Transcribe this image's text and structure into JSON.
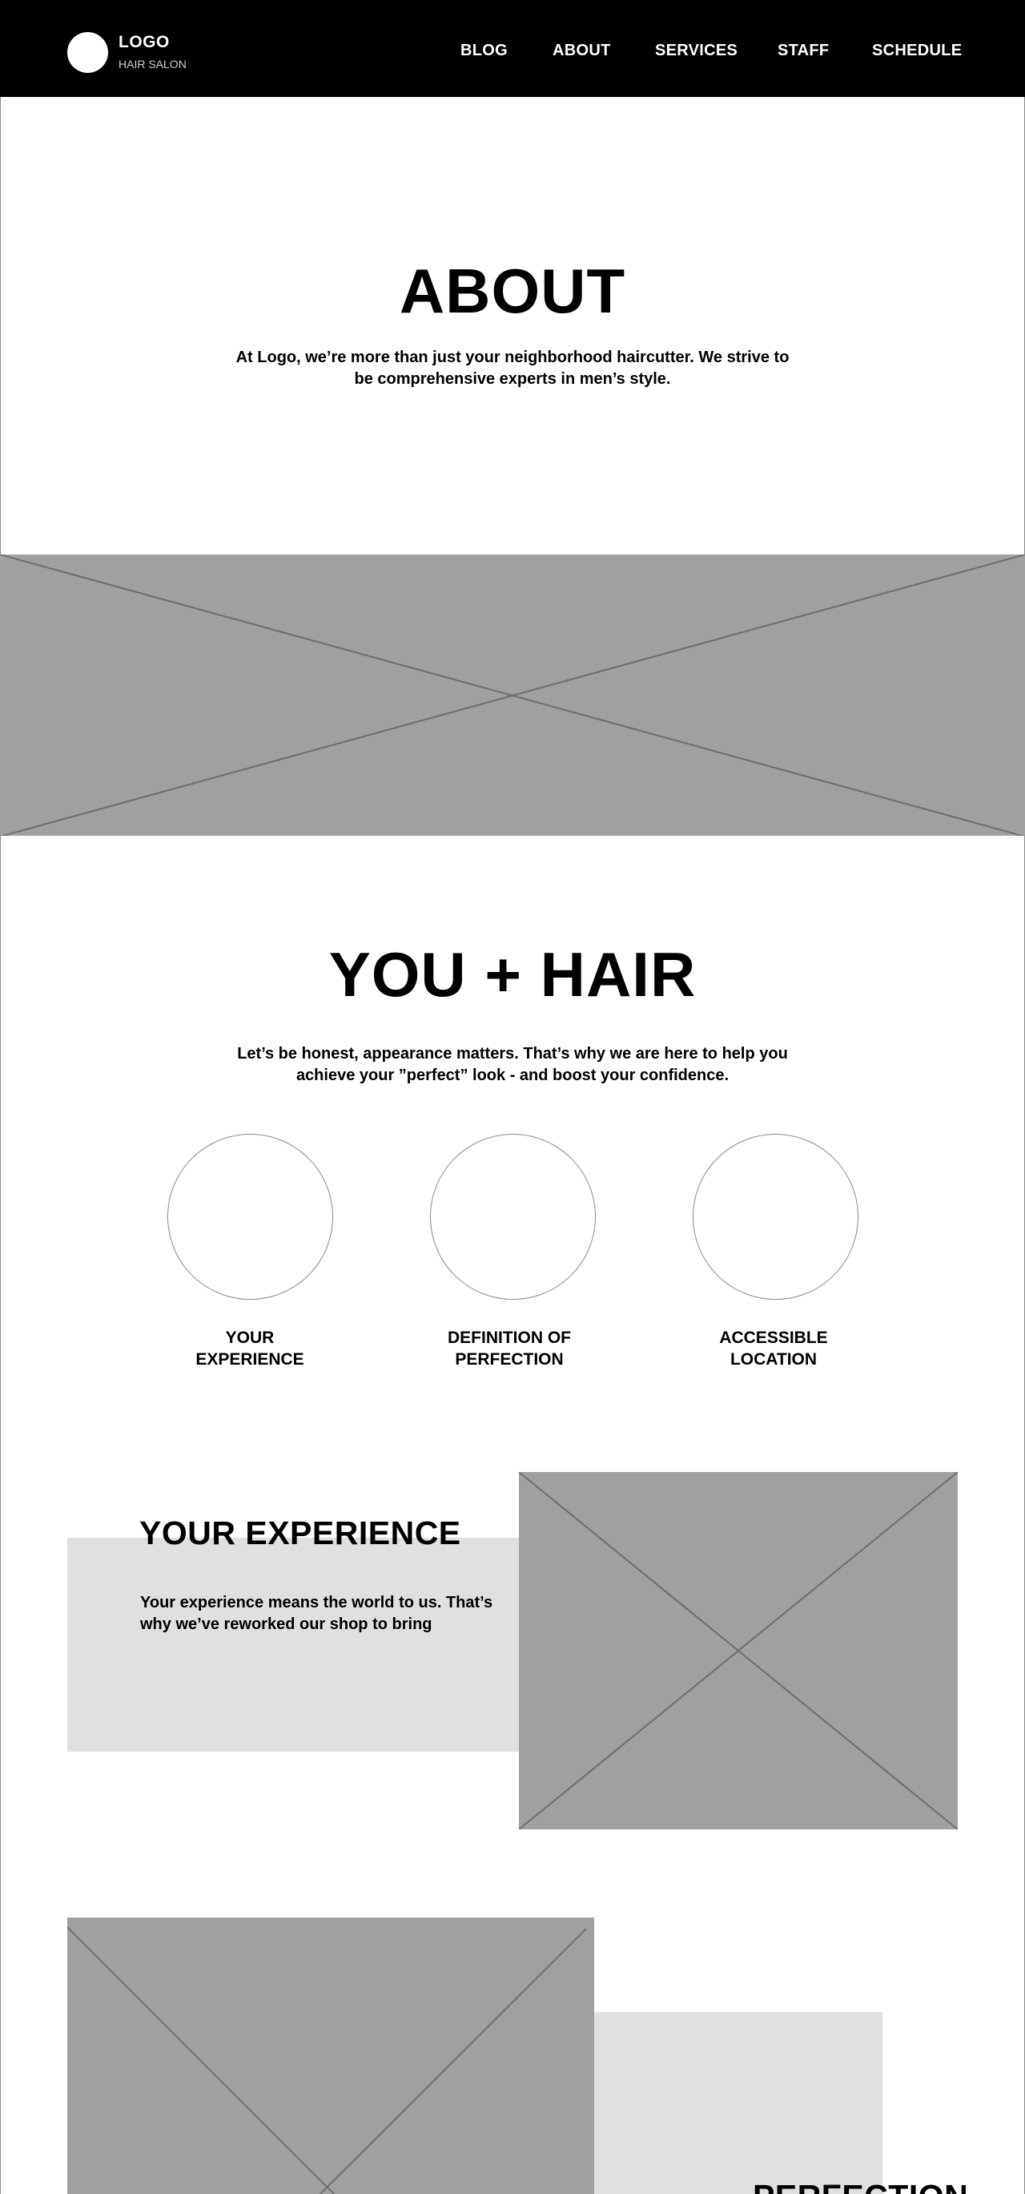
{
  "header": {
    "logo_title": "LOGO",
    "logo_subtitle": "HAIR SALON",
    "nav": [
      "BLOG",
      "ABOUT",
      "SERVICES",
      "STAFF",
      "SCHEDULE"
    ]
  },
  "about": {
    "title": "ABOUT",
    "text": "At Logo, we’re more than just your neighborhood haircutter. We strive to be comprehensive experts in men’s style."
  },
  "you_hair": {
    "title": "YOU + HAIR",
    "text": "Let’s be honest, appearance matters. That’s why we are here to help you achieve your ”perfect” look - and boost your confidence.",
    "features": [
      {
        "label_line1": "YOUR",
        "label_line2": "EXPERIENCE"
      },
      {
        "label_line1": "DEFINITION OF",
        "label_line2": "PERFECTION"
      },
      {
        "label_line1": "ACCESSIBLE",
        "label_line2": "LOCATION"
      }
    ]
  },
  "experience": {
    "title": "YOUR EXPERIENCE",
    "text": "Your experience means the world to us. That’s why we’ve reworked our shop to bring"
  },
  "perfection": {
    "title": "PERFECTION"
  },
  "colors": {
    "nav_bg": "#000000",
    "placeholder": "#a0a0a0",
    "placeholder_lines": "#6e6e6e",
    "beige": "#e2dfdf"
  }
}
